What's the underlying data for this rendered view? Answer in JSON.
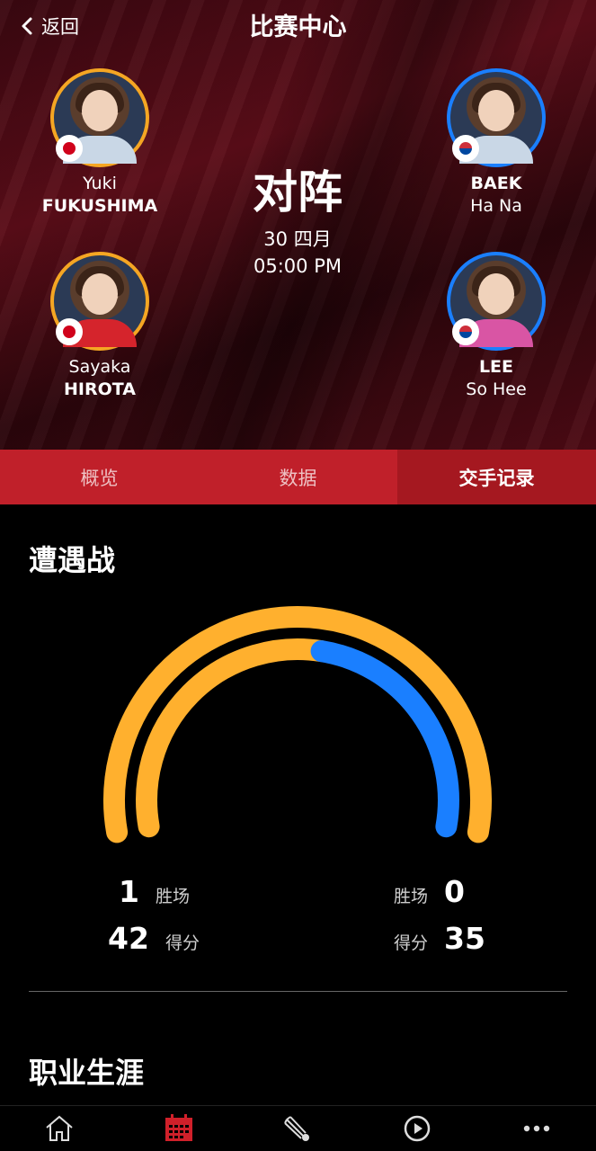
{
  "header": {
    "back_label": "返回",
    "title": "比赛中心"
  },
  "match": {
    "vs_label": "对阵",
    "date": "30 四月",
    "time": "05:00 PM"
  },
  "players": {
    "left_top": {
      "first": "Yuki",
      "last": "FUKUSHIMA",
      "country": "Japan"
    },
    "left_bottom": {
      "first": "Sayaka",
      "last": "HIROTA",
      "country": "Japan"
    },
    "right_top": {
      "last": "BAEK",
      "first": "Ha Na",
      "country": "Korea"
    },
    "right_bottom": {
      "last": "LEE",
      "first": "So Hee",
      "country": "Korea"
    }
  },
  "tabs": [
    {
      "label": "概览",
      "active": false
    },
    {
      "label": "数据",
      "active": false
    },
    {
      "label": "交手记录",
      "active": true
    }
  ],
  "head_to_head": {
    "heading": "遭遇战",
    "left": {
      "wins": "1",
      "wins_label": "胜场",
      "points": "42",
      "points_label": "得分"
    },
    "right": {
      "wins": "0",
      "wins_label": "胜场",
      "points": "35",
      "points_label": "得分"
    },
    "gauge": {
      "outer_share_left": 1.0,
      "inner_share_left": 0.5455,
      "left_color": "#FFB02E",
      "right_color": "#1A7FFF"
    }
  },
  "career": {
    "heading": "职业生涯"
  },
  "nav": [
    {
      "icon": "home-icon"
    },
    {
      "icon": "calendar-icon",
      "active": true
    },
    {
      "icon": "shuttlecock-icon"
    },
    {
      "icon": "play-icon"
    },
    {
      "icon": "more-icon"
    }
  ],
  "colors": {
    "accent_red": "#C0202A",
    "orange": "#FFB02E",
    "blue": "#1A7FFF"
  }
}
